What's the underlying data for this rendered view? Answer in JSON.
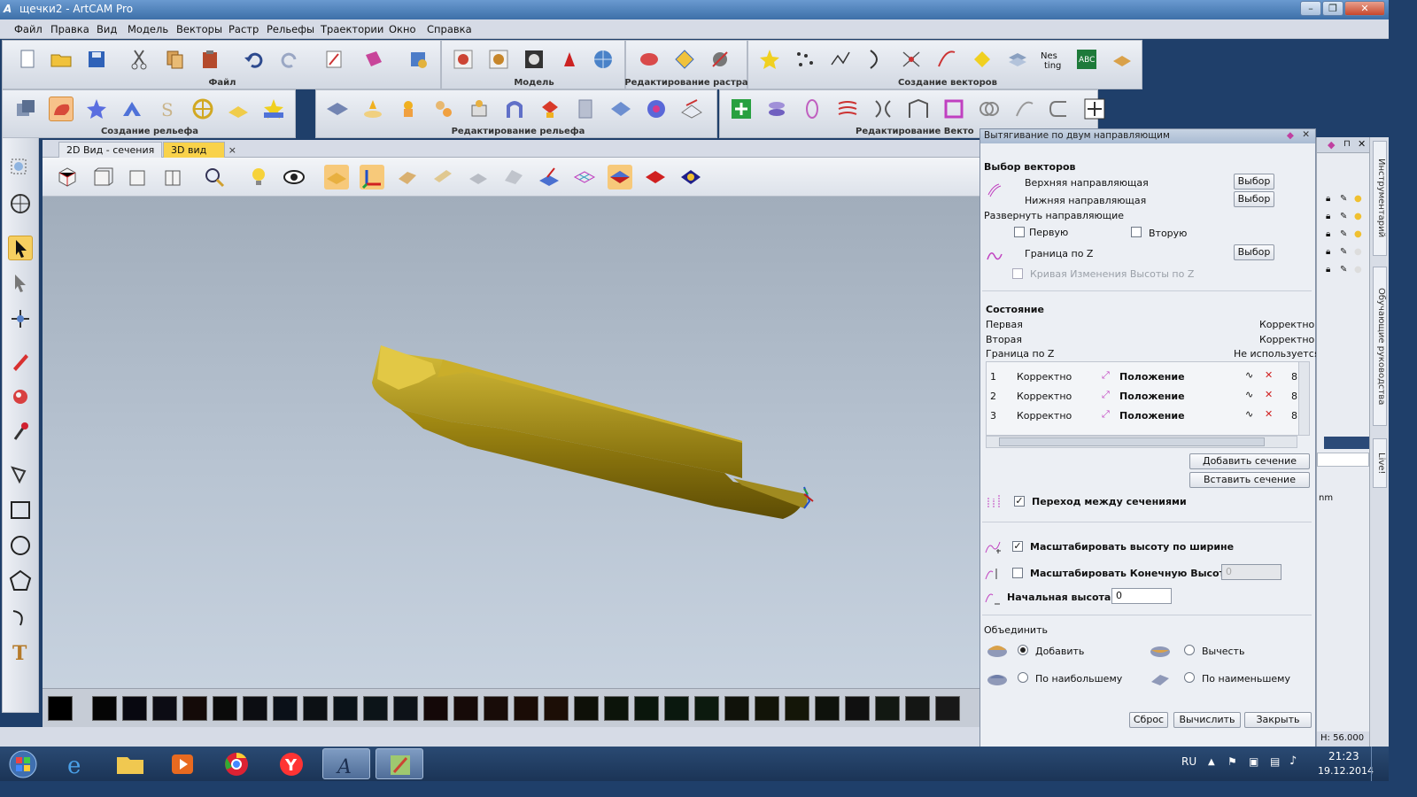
{
  "window": {
    "title": "щечки2 - ArtCAM Pro",
    "app_glyph": "A"
  },
  "menu": [
    "Файл",
    "Правка",
    "Вид",
    "Модель",
    "Векторы",
    "Растр",
    "Рельефы",
    "Траектории",
    "Окно",
    "Справка"
  ],
  "toolbar_groups": {
    "file": "Файл",
    "model": "Модель",
    "raster_edit": "Редактирование растра",
    "vector_create": "Создание векторов",
    "relief_create": "Создание рельефа",
    "relief_edit": "Редактирование рельефа",
    "vector_edit": "Редактирование Векторов"
  },
  "tabs": [
    {
      "label": "2D Вид - сечения",
      "active": false
    },
    {
      "label": "3D вид",
      "active": true,
      "close": "×"
    }
  ],
  "dialog": {
    "title": "Вытягивание по двум направляющим",
    "vectors_heading": "Выбор векторов",
    "upper_rail": "Верхняя направляющая",
    "lower_rail": "Нижняя направляющая",
    "select_label": "Выбор",
    "reverse_heading": "Развернуть направляющие",
    "first": "Первую",
    "second": "Вторую",
    "z_boundary": "Граница по Z",
    "z_curve": "Кривая Изменения Высоты по Z",
    "state_heading": "Состояние",
    "state": [
      {
        "label": "Первая",
        "value": "Корректно"
      },
      {
        "label": "Вторая",
        "value": "Корректно"
      },
      {
        "label": "Граница по Z",
        "value": "Не используется"
      }
    ],
    "sections": [
      {
        "num": "1",
        "status": "Корректно",
        "pos": "Положение",
        "tail": "8"
      },
      {
        "num": "2",
        "status": "Корректно",
        "pos": "Положение",
        "tail": "8"
      },
      {
        "num": "3",
        "status": "Корректно",
        "pos": "Положение",
        "tail": "8"
      }
    ],
    "add_section": "Добавить сечение",
    "insert_section": "Вставить сечение",
    "transition": {
      "label": "Переход между сечениями",
      "checked": true
    },
    "scale_height": {
      "label": "Масштабировать высоту по ширине",
      "checked": true
    },
    "scale_final": {
      "label": "Масштабировать Конечную Высоту",
      "checked": false,
      "value": "0"
    },
    "start_height": {
      "label": "Начальная высота",
      "value": "0"
    },
    "combine_heading": "Объединить",
    "combine": {
      "add": "Добавить",
      "subtract": "Вычесть",
      "max": "По наибольшему",
      "min": "По наименьшему",
      "selected": "add"
    },
    "reset": "Сброс",
    "compute": "Вычислить",
    "close": "Закрыть"
  },
  "right_panel": {
    "tabs": [
      "Инструментарий",
      "Обучающие руководства",
      "Live!"
    ],
    "status_h": "H: 56.000",
    "unit": "nm"
  },
  "taskbar": {
    "lang": "RU",
    "time": "21:23",
    "date": "19.12.2014"
  },
  "colors": {
    "model": "#b89a1e",
    "accent_tab": "#f9d24a",
    "viewport_top": "#a1adbb",
    "viewport_bottom": "#c7d2df"
  }
}
